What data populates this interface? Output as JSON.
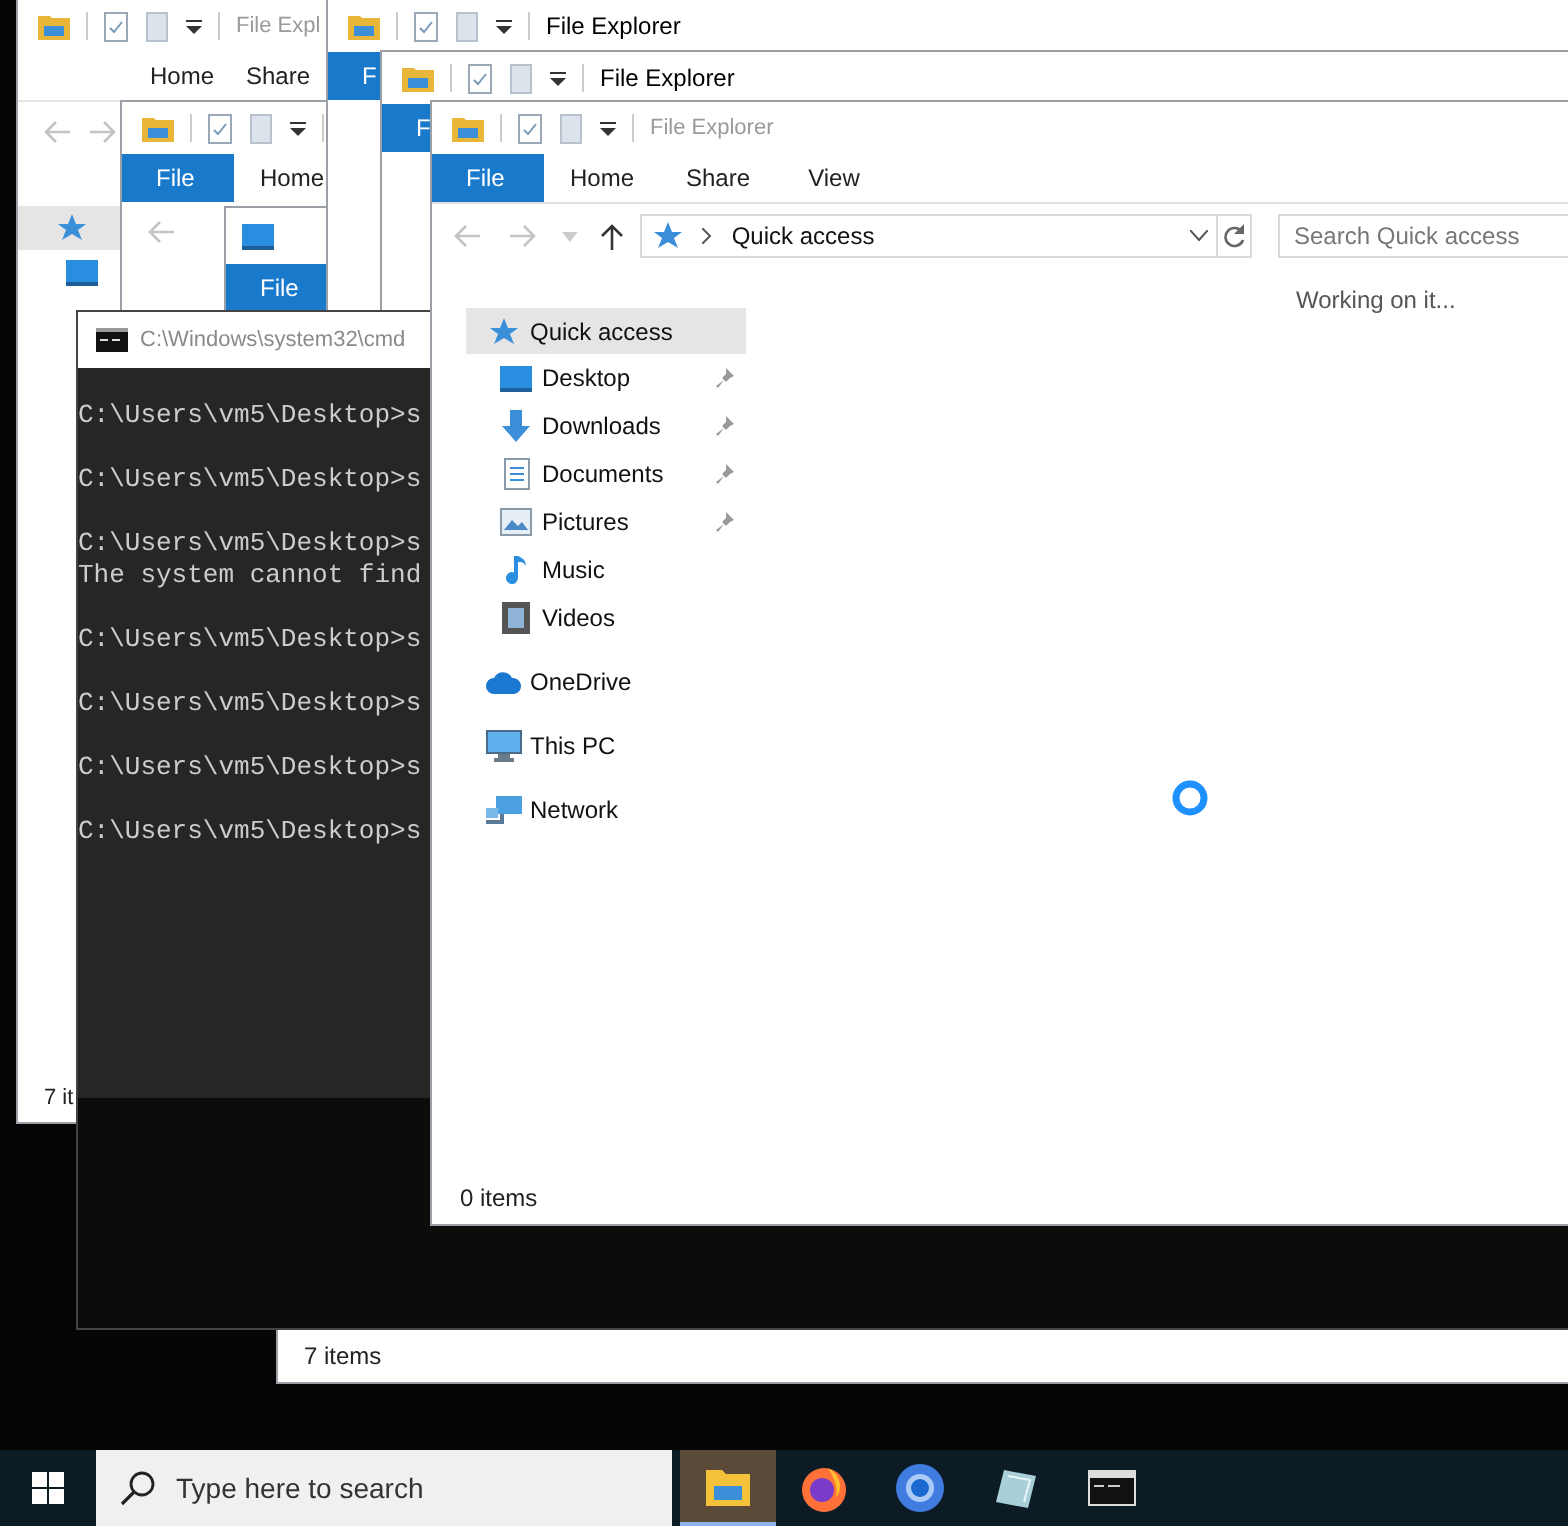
{
  "explorer_bottom": {
    "status": "7 items"
  },
  "explorer_left": {
    "title": "File Expl",
    "tabs": [
      {
        "label": "Home",
        "kind": "tab"
      },
      {
        "label": "Share",
        "kind": "tab"
      }
    ],
    "status": "7 it"
  },
  "explorer_2": {
    "title": "File Explorer",
    "tabs": [
      {
        "label": "F",
        "kind": "file"
      }
    ]
  },
  "explorer_3": {
    "title": "File Explorer",
    "tabs": [
      {
        "label": "F",
        "kind": "file"
      }
    ]
  },
  "explorer_4": {
    "tabs": [
      {
        "label": "File",
        "kind": "file"
      },
      {
        "label": "Home",
        "kind": "tab"
      }
    ]
  },
  "explorer_5": {
    "tabs": [
      {
        "label": "File",
        "kind": "file"
      }
    ]
  },
  "console": {
    "title": "C:\\Windows\\system32\\cmd",
    "lines": [
      {
        "text": "C:\\Users\\vm5\\Desktop>s",
        "kind": "prompt"
      },
      {
        "text": "C:\\Users\\vm5\\Desktop>s",
        "kind": "prompt"
      },
      {
        "text": "C:\\Users\\vm5\\Desktop>s",
        "kind": "prompt"
      },
      {
        "text": "The system cannot find",
        "kind": "output"
      },
      {
        "text": "C:\\Users\\vm5\\Desktop>s",
        "kind": "prompt"
      },
      {
        "text": "C:\\Users\\vm5\\Desktop>s",
        "kind": "prompt"
      },
      {
        "text": "C:\\Users\\vm5\\Desktop>s",
        "kind": "prompt"
      },
      {
        "text": "C:\\Users\\vm5\\Desktop>s",
        "kind": "prompt"
      }
    ]
  },
  "explorer_main": {
    "title": "File Explorer",
    "tabs": [
      {
        "label": "File",
        "kind": "file"
      },
      {
        "label": "Home",
        "kind": "tab"
      },
      {
        "label": "Share",
        "kind": "tab"
      },
      {
        "label": "View",
        "kind": "tab"
      }
    ],
    "address": "Quick access",
    "search": {
      "placeholder": "Search Quick access"
    },
    "nav": [
      {
        "label": "Quick access",
        "kind": "star",
        "selected": true,
        "children": [
          {
            "label": "Desktop",
            "kind": "desktop",
            "pinned": true,
            "selected": false
          },
          {
            "label": "Downloads",
            "kind": "download",
            "pinned": true,
            "selected": false
          },
          {
            "label": "Documents",
            "kind": "documents",
            "pinned": true,
            "selected": false
          },
          {
            "label": "Pictures",
            "kind": "pictures",
            "pinned": true,
            "selected": false
          },
          {
            "label": "Music",
            "kind": "music",
            "pinned": false,
            "selected": false
          },
          {
            "label": "Videos",
            "kind": "videos",
            "pinned": false,
            "selected": false
          }
        ]
      },
      {
        "label": "OneDrive",
        "kind": "cloud",
        "selected": false
      },
      {
        "label": "This PC",
        "kind": "pc",
        "selected": false
      },
      {
        "label": "Network",
        "kind": "network",
        "selected": false
      }
    ],
    "message": "Working on it...",
    "status": "0 items"
  },
  "taskbar": {
    "search": {
      "placeholder": "Type here to search"
    },
    "apps": [
      {
        "kind": "folder",
        "active": true
      },
      {
        "kind": "firefox",
        "active": false
      },
      {
        "kind": "chrome",
        "active": false
      },
      {
        "kind": "notes",
        "active": false
      },
      {
        "kind": "terminal",
        "active": false
      }
    ]
  }
}
